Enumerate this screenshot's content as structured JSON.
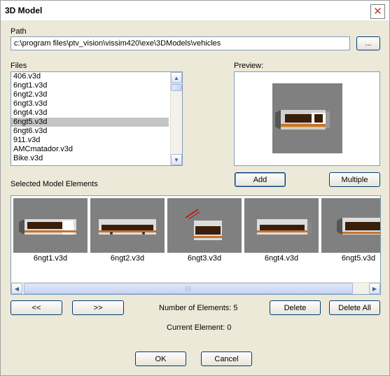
{
  "window": {
    "title": "3D Model",
    "close_icon": "close-icon"
  },
  "path": {
    "label": "Path",
    "value": "c:\\program files\\ptv_vision\\vissim420\\exe\\3DModels\\vehicles",
    "browse_label": "..."
  },
  "files": {
    "label": "Files",
    "items": [
      "406.v3d",
      "6ngt1.v3d",
      "6ngt2.v3d",
      "6ngt3.v3d",
      "6ngt4.v3d",
      "6ngt5.v3d",
      "6ngt6.v3d",
      "911.v3d",
      "AMCmatador.v3d",
      "Bike.v3d"
    ],
    "selected": "6ngt5.v3d"
  },
  "preview": {
    "label": "Preview:"
  },
  "buttons": {
    "add": "Add",
    "multiple": "Multiple",
    "prev": "<<",
    "next": ">>",
    "delete": "Delete",
    "delete_all": "Delete All",
    "ok": "OK",
    "cancel": "Cancel"
  },
  "selected_elements": {
    "label": "Selected Model Elements",
    "items": [
      "6ngt1.v3d",
      "6ngt2.v3d",
      "6ngt3.v3d",
      "6ngt4.v3d",
      "6ngt5.v3d"
    ]
  },
  "status": {
    "number_of_elements": "Number of Elements: 5",
    "current_element": "Current Element: 0"
  }
}
